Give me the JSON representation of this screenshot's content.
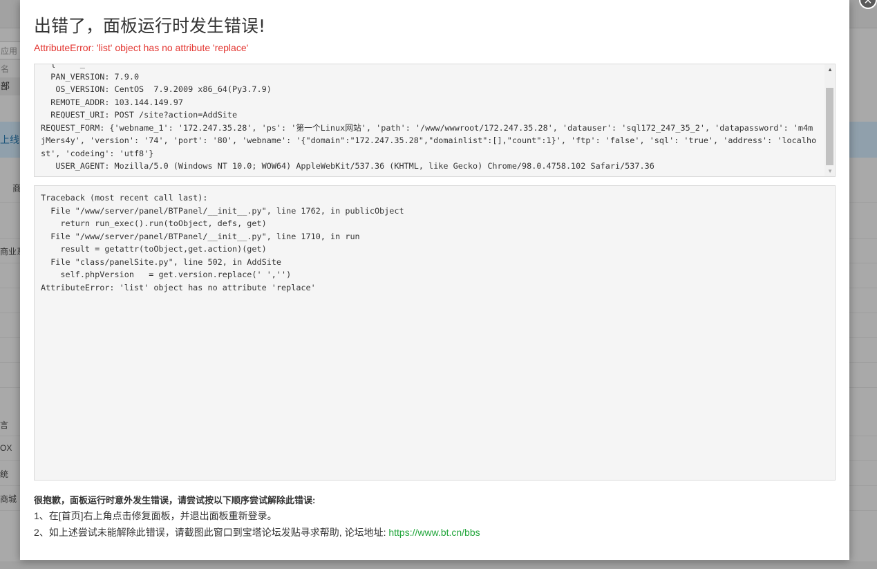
{
  "background": {
    "search_placeholder": "应用名",
    "tab_label": "部",
    "banner_text": "上线",
    "items": [
      "商",
      "商业系",
      "言",
      "OX",
      "统",
      "商城"
    ]
  },
  "dialog": {
    "close_symbol": "×",
    "title": "出错了，面板运行时发生错误!",
    "error_message": "AttributeError: 'list' object has no attribute 'replace'",
    "info_text": "  {'    _\n  PAN_VERSION: 7.9.0\n   OS_VERSION: CentOS  7.9.2009 x86_64(Py3.7.9)\n  REMOTE_ADDR: 103.144.149.97\n  REQUEST_URI: POST /site?action=AddSite\nREQUEST_FORM: {'webname_1': '172.247.35.28', 'ps': '第一个Linux网站', 'path': '/www/wwwroot/172.247.35.28', 'datauser': 'sql172_247_35_2', 'datapassword': 'm4mjMers4y', 'version': '74', 'port': '80', 'webname': '{\"domain\":\"172.247.35.28\",\"domainlist\":[],\"count\":1}', 'ftp': 'false', 'sql': 'true', 'address': 'localhost', 'codeing': 'utf8'}\n   USER_AGENT: Mozilla/5.0 (Windows NT 10.0; WOW64) AppleWebKit/537.36 (KHTML, like Gecko) Chrome/98.0.4758.102 Safari/537.36",
    "traceback_text": "Traceback (most recent call last):\n  File \"/www/server/panel/BTPanel/__init__.py\", line 1762, in publicObject\n    return run_exec().run(toObject, defs, get)\n  File \"/www/server/panel/BTPanel/__init__.py\", line 1710, in run\n    result = getattr(toObject,get.action)(get)\n  File \"class/panelSite.py\", line 502, in AddSite\n    self.phpVersion   = get.version.replace(' ','')\nAttributeError: 'list' object has no attribute 'replace'",
    "help_title": "很抱歉，面板运行时意外发生错误，请尝试按以下顺序尝试解除此错误:",
    "help_step1": "1、在[首页]右上角点击修复面板，并退出面板重新登录。",
    "help_step2_prefix": "2、如上述尝试未能解除此错误，请截图此窗口到宝塔论坛发贴寻求帮助, 论坛地址: ",
    "help_link": "https://www.bt.cn/bbs"
  },
  "colors": {
    "error_red": "#e3342f",
    "link_green": "#20a53a"
  },
  "icons": {
    "close": "close-icon",
    "scroll_up": "arrow-up-icon",
    "scroll_down": "arrow-down-icon"
  }
}
